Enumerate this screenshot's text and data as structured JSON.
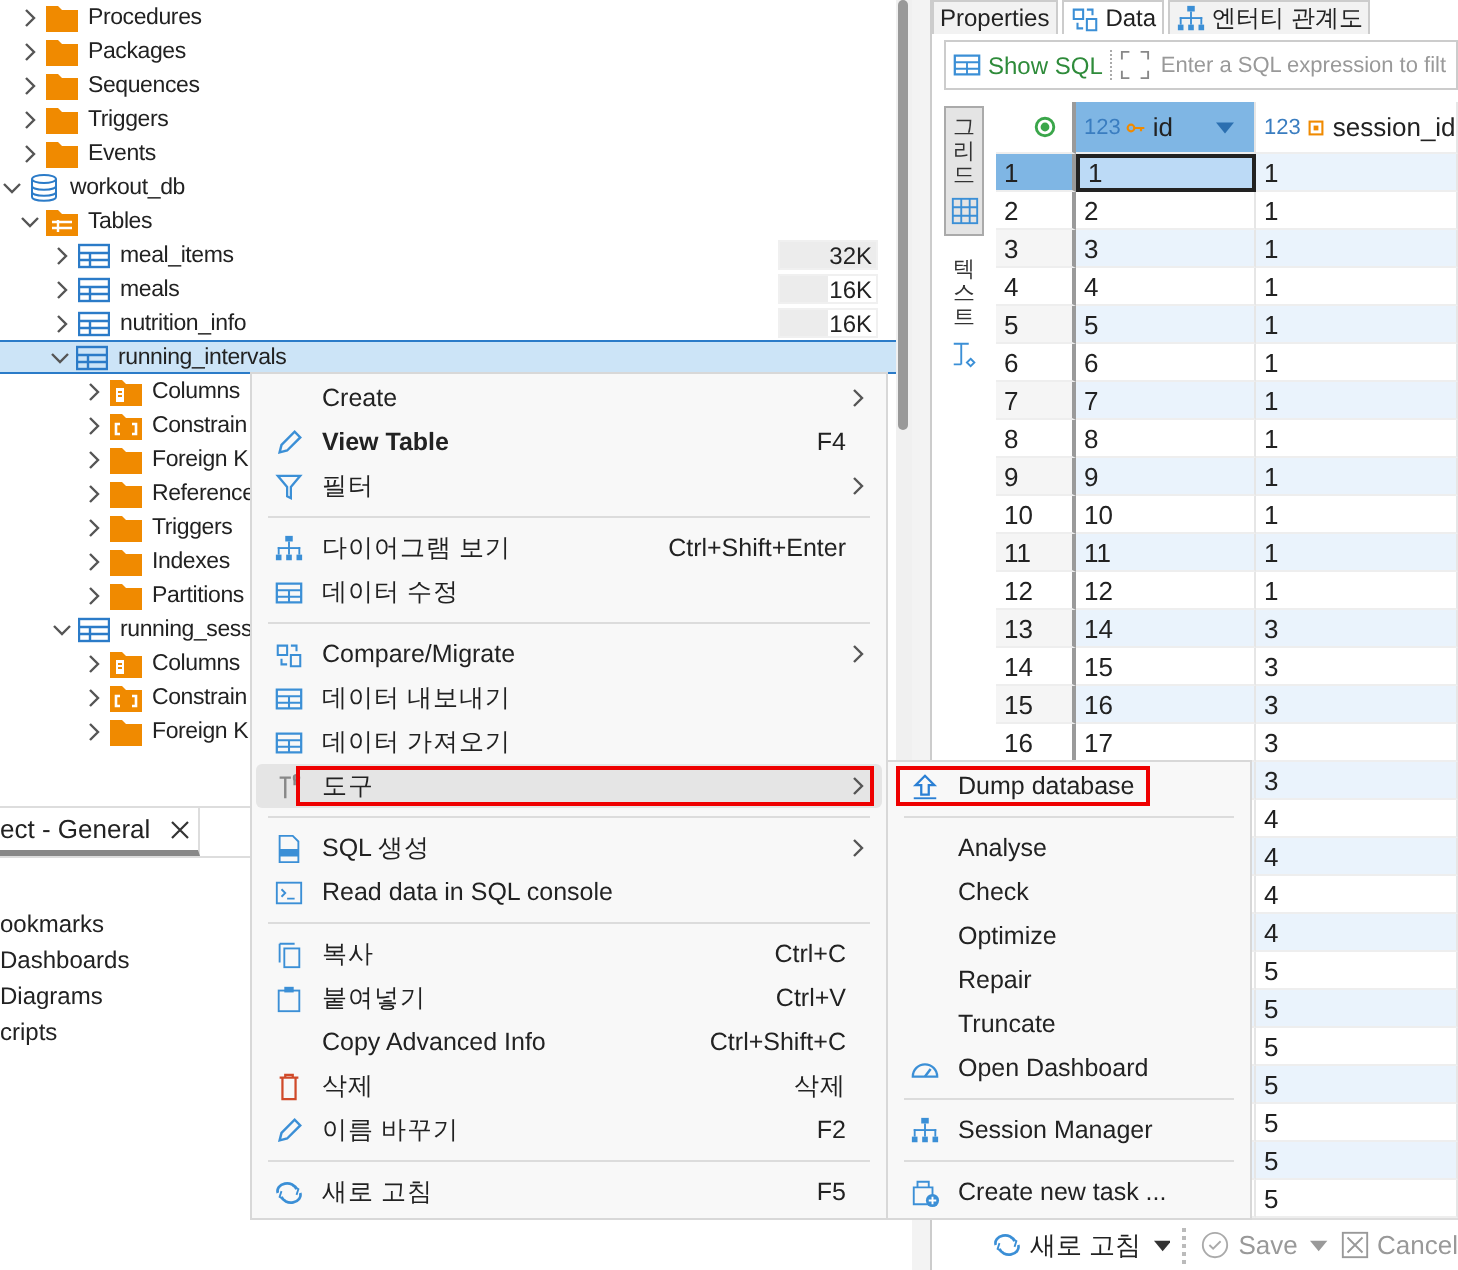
{
  "tree": [
    {
      "children": [
        {
          "kind": "folder",
          "label": "Procedures",
          "expanded": false,
          "selected": false
        },
        {
          "kind": "folder",
          "label": "Packages",
          "expanded": false,
          "selected": false
        },
        {
          "kind": "folder",
          "label": "Sequences",
          "expanded": false,
          "selected": false
        },
        {
          "kind": "folder",
          "label": "Triggers",
          "expanded": false,
          "selected": false
        },
        {
          "kind": "folder",
          "label": "Events",
          "expanded": false,
          "selected": false
        }
      ]
    },
    {
      "kind": "database",
      "label": "workout_db",
      "expanded": true,
      "selected": false,
      "children": [
        {
          "kind": "tables",
          "label": "Tables",
          "expanded": true,
          "selected": false,
          "children": [
            {
              "kind": "table",
              "label": "meal_items",
              "expanded": false,
              "selected": false,
              "size": "32K",
              "level": 1
            },
            {
              "kind": "table",
              "label": "meals",
              "expanded": false,
              "selected": false,
              "size": "16K",
              "level": 0.5
            },
            {
              "kind": "table",
              "label": "nutrition_info",
              "expanded": false,
              "selected": false,
              "size": "16K",
              "level": 0.5
            },
            {
              "kind": "table",
              "label": "running_intervals",
              "expanded": true,
              "selected": true,
              "children": [
                {
                  "kind": "columns",
                  "label": "Columns",
                  "expanded": false,
                  "selected": false
                },
                {
                  "kind": "constraints",
                  "label": "Constrain",
                  "expanded": false,
                  "selected": false
                },
                {
                  "kind": "folder",
                  "label": "Foreign K",
                  "expanded": false,
                  "selected": false
                },
                {
                  "kind": "folder",
                  "label": "Reference",
                  "expanded": false,
                  "selected": false
                },
                {
                  "kind": "folder",
                  "label": "Triggers",
                  "expanded": false,
                  "selected": false
                },
                {
                  "kind": "folder",
                  "label": "Indexes",
                  "expanded": false,
                  "selected": false
                },
                {
                  "kind": "folder",
                  "label": "Partitions",
                  "expanded": false,
                  "selected": false
                }
              ]
            },
            {
              "kind": "table",
              "label": "running_sess",
              "expanded": true,
              "selected": false,
              "children": [
                {
                  "kind": "columns",
                  "label": "Columns",
                  "expanded": false,
                  "selected": false
                },
                {
                  "kind": "constraints",
                  "label": "Constrain",
                  "expanded": false,
                  "selected": false
                },
                {
                  "kind": "folder",
                  "label": "Foreign K",
                  "expanded": false,
                  "selected": false
                }
              ]
            }
          ]
        }
      ]
    }
  ],
  "bottom_panel": {
    "tab": {
      "label": "ect - General",
      "selected": true
    },
    "items": [
      "ookmarks",
      "Dashboards",
      "Diagrams",
      "cripts"
    ]
  },
  "editor_tabs": [
    {
      "label": "Properties",
      "selected": false
    },
    {
      "label": "Data",
      "selected": true
    },
    {
      "label": "엔터티 관계도",
      "selected": false
    }
  ],
  "toolbar": {
    "show_sql": "Show SQL",
    "filter": {
      "placeholder": "Enter a SQL expression to filt"
    }
  },
  "view_tabs": [
    {
      "label": "그리드",
      "selected": true
    },
    {
      "label": "텍스트",
      "selected": false
    }
  ],
  "grid": {
    "columns": [
      {
        "type": "123",
        "name": "id",
        "selected": true
      },
      {
        "type": "123",
        "name": "session_id",
        "selected": false
      }
    ],
    "rows": [
      {
        "number": "1",
        "id": "1",
        "session_id": "1",
        "selected": true
      },
      {
        "number": "2",
        "id": "2",
        "session_id": "1",
        "selected": false
      },
      {
        "number": "3",
        "id": "3",
        "session_id": "1",
        "selected": false
      },
      {
        "number": "4",
        "id": "4",
        "session_id": "1",
        "selected": false
      },
      {
        "number": "5",
        "id": "5",
        "session_id": "1",
        "selected": false
      },
      {
        "number": "6",
        "id": "6",
        "session_id": "1",
        "selected": false
      },
      {
        "number": "7",
        "id": "7",
        "session_id": "1",
        "selected": false
      },
      {
        "number": "8",
        "id": "8",
        "session_id": "1",
        "selected": false
      },
      {
        "number": "9",
        "id": "9",
        "session_id": "1",
        "selected": false
      },
      {
        "number": "10",
        "id": "10",
        "session_id": "1",
        "selected": false
      },
      {
        "number": "11",
        "id": "11",
        "session_id": "1",
        "selected": false
      },
      {
        "number": "12",
        "id": "12",
        "session_id": "1",
        "selected": false
      },
      {
        "number": "13",
        "id": "14",
        "session_id": "3",
        "selected": false
      },
      {
        "number": "14",
        "id": "15",
        "session_id": "3",
        "selected": false
      },
      {
        "number": "15",
        "id": "16",
        "session_id": "3",
        "selected": false
      },
      {
        "number": "16",
        "id": "17",
        "session_id": "3",
        "selected": false
      },
      {
        "session_id": "3"
      },
      {
        "session_id": "4"
      },
      {
        "session_id": "4"
      },
      {
        "session_id": "4"
      },
      {
        "session_id": "4"
      },
      {
        "session_id": "5"
      },
      {
        "session_id": "5"
      },
      {
        "session_id": "5"
      },
      {
        "session_id": "5"
      },
      {
        "session_id": "5"
      },
      {
        "session_id": "5"
      },
      {
        "session_id": "5"
      }
    ]
  },
  "bottom_toolbar": [
    {
      "label": "새로 고침",
      "disabled": false,
      "dropdown": true
    },
    {
      "label": "Save",
      "disabled": true,
      "dropdown": true
    },
    {
      "label": "Cancel",
      "disabled": true
    }
  ],
  "context_menu": [
    {
      "kind": "item",
      "label": "Create",
      "arrow": true,
      "selected": false
    },
    {
      "kind": "item",
      "label": "View Table",
      "shortcut": "F4",
      "bold": true,
      "selected": false
    },
    {
      "kind": "item",
      "label": "필터",
      "arrow": true,
      "selected": false
    },
    {
      "kind": "separator"
    },
    {
      "kind": "item",
      "label": "다이어그램 보기",
      "shortcut": "Ctrl+Shift+Enter",
      "selected": false
    },
    {
      "kind": "item",
      "label": "데이터 수정",
      "selected": false
    },
    {
      "kind": "separator"
    },
    {
      "kind": "item",
      "label": "Compare/Migrate",
      "arrow": true,
      "selected": false
    },
    {
      "kind": "item",
      "label": "데이터 내보내기",
      "selected": false
    },
    {
      "kind": "item",
      "label": "데이터 가져오기",
      "selected": false
    },
    {
      "kind": "item",
      "label": "도구",
      "arrow": true,
      "selected": true,
      "annotated": true,
      "submenu": [
        {
          "kind": "item",
          "label": "Dump database",
          "selected": false,
          "annotated": true
        },
        {
          "kind": "separator"
        },
        {
          "kind": "item",
          "label": "Analyse",
          "selected": false
        },
        {
          "kind": "item",
          "label": "Check",
          "selected": false
        },
        {
          "kind": "item",
          "label": "Optimize",
          "selected": false
        },
        {
          "kind": "item",
          "label": "Repair",
          "selected": false
        },
        {
          "kind": "item",
          "label": "Truncate",
          "selected": false
        },
        {
          "kind": "item",
          "label": "Open Dashboard",
          "selected": false
        },
        {
          "kind": "separator"
        },
        {
          "kind": "item",
          "label": "Session Manager",
          "selected": false
        },
        {
          "kind": "separator"
        },
        {
          "kind": "item",
          "label": "Create new task ...",
          "selected": false
        }
      ]
    },
    {
      "kind": "separator"
    },
    {
      "kind": "item",
      "label": "SQL 생성",
      "arrow": true,
      "selected": false
    },
    {
      "kind": "item",
      "label": "Read data in SQL console",
      "selected": false
    },
    {
      "kind": "separator"
    },
    {
      "kind": "item",
      "label": "복사",
      "shortcut": "Ctrl+C",
      "selected": false
    },
    {
      "kind": "item",
      "label": "붙여넣기",
      "shortcut": "Ctrl+V",
      "selected": false
    },
    {
      "kind": "item",
      "label": "Copy Advanced Info",
      "shortcut": "Ctrl+Shift+C",
      "selected": false
    },
    {
      "kind": "item",
      "label": "삭제",
      "shortcut": "삭제",
      "selected": false
    },
    {
      "kind": "item",
      "label": "이름 바꾸기",
      "shortcut": "F2",
      "selected": false
    },
    {
      "kind": "separator"
    },
    {
      "kind": "item",
      "label": "새로 고침",
      "shortcut": "F5",
      "selected": false
    }
  ]
}
